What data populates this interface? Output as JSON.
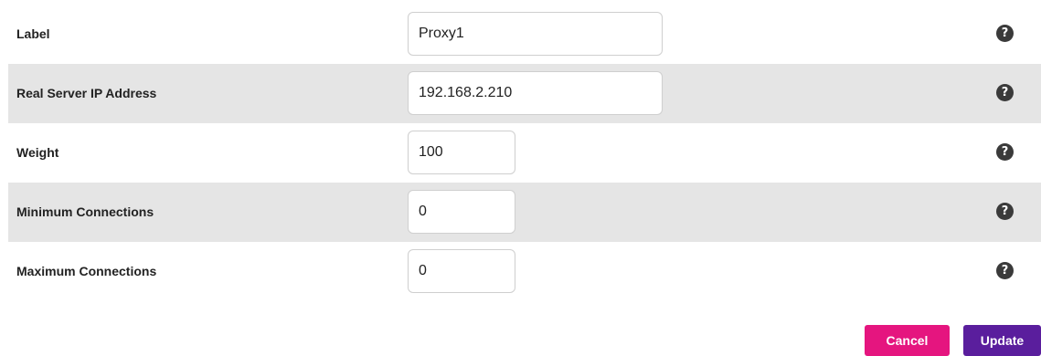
{
  "fields": [
    {
      "label": "Label",
      "value": "Proxy1"
    },
    {
      "label": "Real Server IP Address",
      "value": "192.168.2.210"
    },
    {
      "label": "Weight",
      "value": "100"
    },
    {
      "label": "Minimum Connections",
      "value": "0"
    },
    {
      "label": "Maximum Connections",
      "value": "0"
    }
  ],
  "help_glyph": "?",
  "help_icon": "question-circle-icon",
  "actions": {
    "cancel_label": "Cancel",
    "update_label": "Update"
  },
  "colors": {
    "row_shade": "#e5e5e5",
    "cancel": "#e5157f",
    "update": "#5a1e9d",
    "help": "#3a3a3a"
  }
}
